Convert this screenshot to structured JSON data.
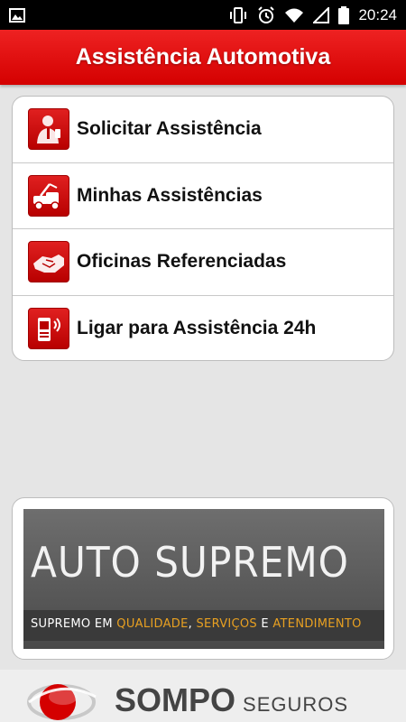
{
  "status_bar": {
    "time": "20:24",
    "icons": [
      "image-icon",
      "vibrate-icon",
      "alarm-icon",
      "wifi-icon",
      "signal-icon",
      "battery-icon"
    ]
  },
  "app_bar": {
    "title": "Assistência Automotiva"
  },
  "menu": {
    "items": [
      {
        "label": "Solicitar Assistência",
        "icon": "person-phone-icon"
      },
      {
        "label": "Minhas Assistências",
        "icon": "tow-truck-icon"
      },
      {
        "label": "Oficinas Referenciadas",
        "icon": "handshake-icon"
      },
      {
        "label": "Ligar para Assistência 24h",
        "icon": "mobile-phone-icon"
      }
    ]
  },
  "banner": {
    "title": "AUTO SUPREMO",
    "tagline_parts": [
      "SUPREMO EM ",
      "QUALIDADE",
      ", ",
      "SERVIÇOS",
      " E ",
      "ATENDIMENTO"
    ]
  },
  "footer": {
    "brand": "SOMPO",
    "brand_sub": "SEGUROS"
  },
  "colors": {
    "primary": "#d40000",
    "accent": "#e8a021",
    "background": "#e5e5e5"
  }
}
